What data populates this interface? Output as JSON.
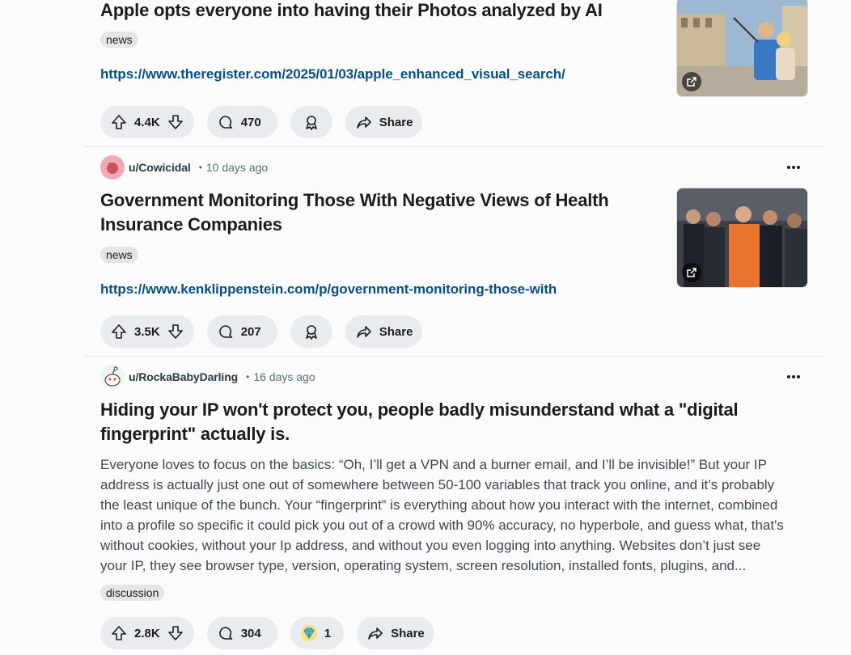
{
  "posts": [
    {
      "title": "Apple opts everyone into having their Photos analyzed by AI",
      "flair": "news",
      "link": "https://www.theregister.com/2025/01/03/apple_enhanced_visual_search/",
      "votes": "4.4K",
      "comments": "470",
      "share_label": "Share"
    },
    {
      "username": "u/Cowicidal",
      "time": "10 days ago",
      "title_lines": [
        "Government Monitoring Those With Negative Views of Health",
        "Insurance Companies"
      ],
      "flair": "news",
      "link": "https://www.kenklippenstein.com/p/government-monitoring-those-with",
      "votes": "3.5K",
      "comments": "207",
      "share_label": "Share"
    },
    {
      "username": "u/RockaBabyDarling",
      "time": "16 days ago",
      "title_lines": [
        "Hiding your IP won't protect you, people badly misunderstand what a \"digital",
        "fingerprint\" actually is."
      ],
      "body_lines": [
        "Everyone loves to focus on the basics: “Oh, I’ll get a VPN and a burner email, and I’ll be invisible!” But your IP",
        "address is actually just one out of somewhere between 50-100 variables that track you online, and it’s probably",
        "the least unique of the bunch. Your “fingerprint” is everything about how you interact with the internet, combined",
        "into a profile so specific it could pick you out of a crowd with 90% accuracy, no hyperbole, and guess what, that's",
        "without cookies, without your Ip address, and without you even logging into anything. Websites don’t just see",
        "your IP, they see browser type, version, operating system, screen resolution, installed fonts, plugins, and..."
      ],
      "flair": "discussion",
      "votes": "2.8K",
      "comments": "304",
      "award_count": "1",
      "share_label": "Share"
    }
  ],
  "icons": {
    "upvote": "upvote-icon",
    "downvote": "downvote-icon",
    "comment": "comment-icon",
    "award": "award-icon",
    "share": "share-icon",
    "more": "more-options-icon",
    "external": "external-link-icon"
  },
  "colors": {
    "link": "#0a4f82",
    "pill_bg": "#e9ecef",
    "flair_bg": "#e5e5e5"
  }
}
